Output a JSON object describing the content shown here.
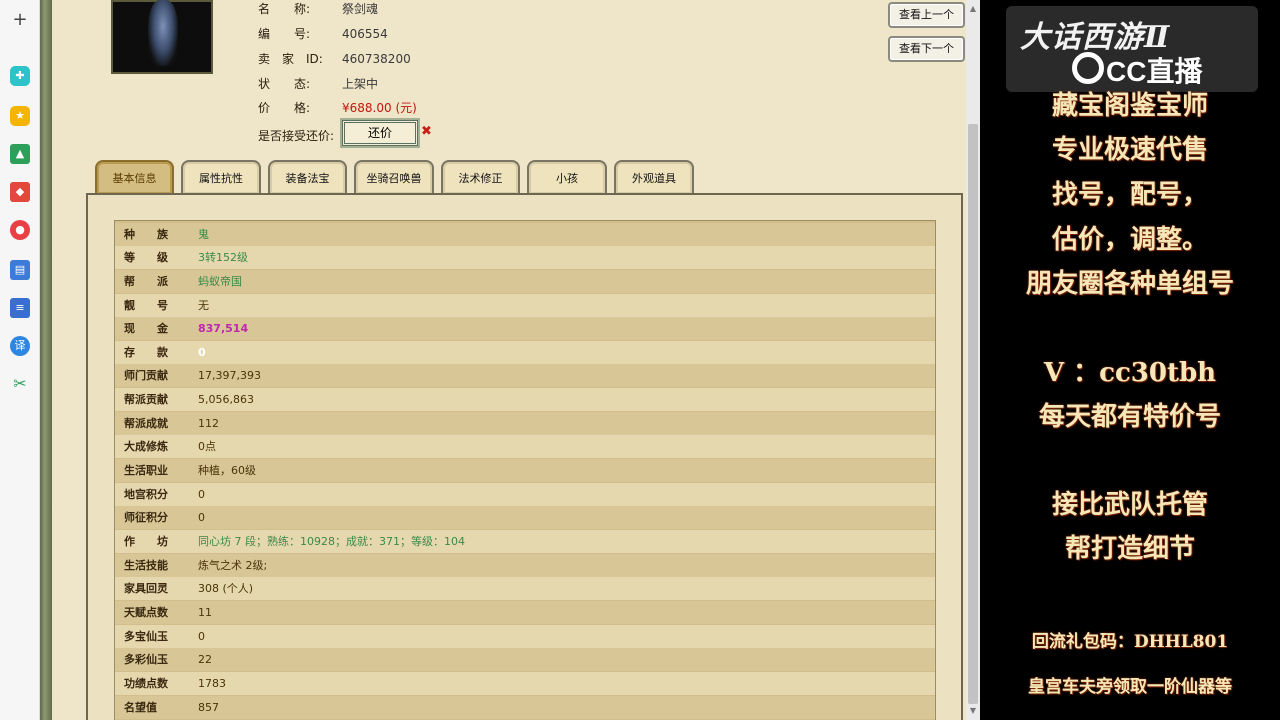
{
  "strip": {
    "plus": "+",
    "icons": [
      "app-icon-1",
      "star-icon",
      "image-ai-icon",
      "pdf-ai-icon",
      "record-ai-icon",
      "chart-ai-icon",
      "doc-ai-icon",
      "translate-icon",
      "scissors-icon"
    ],
    "translate_label": "译"
  },
  "item": {
    "name_label": "名　　称:",
    "name": "祭剑魂",
    "serial_label": "编　　号:",
    "serial": "406554",
    "seller_label": "卖　家　ID:",
    "seller_id": "460738200",
    "status_label": "状　　态:",
    "status": "上架中",
    "price_label": "价　　格:",
    "price": "¥688.00 (元)",
    "counter_label": "是否接受还价:",
    "counter_button": "还价",
    "counter_x": "✖"
  },
  "nav": {
    "prev": "查看上一个",
    "next": "查看下一个"
  },
  "tabs": [
    {
      "label": "基本信息",
      "active": true
    },
    {
      "label": "属性抗性",
      "active": false
    },
    {
      "label": "装备法宝",
      "active": false
    },
    {
      "label": "坐骑召唤兽",
      "active": false
    },
    {
      "label": "法术修正",
      "active": false
    },
    {
      "label": "小孩",
      "active": false
    },
    {
      "label": "外观道具",
      "active": false
    }
  ],
  "rows": [
    {
      "label": "种　　族",
      "value": "鬼",
      "style": "green"
    },
    {
      "label": "等　　级",
      "value": "3转152级",
      "style": "green"
    },
    {
      "label": "帮　　派",
      "value": "蚂蚁帝国",
      "style": "green"
    },
    {
      "label": "靓　　号",
      "value": "无",
      "style": "brown"
    },
    {
      "label": "现　　金",
      "value": "837,514",
      "style": "pink"
    },
    {
      "label": "存　　款",
      "value": "0",
      "style": "white"
    },
    {
      "label": "师门贡献",
      "value": "17,397,393",
      "style": "brown"
    },
    {
      "label": "帮派贡献",
      "value": "5,056,863",
      "style": "brown"
    },
    {
      "label": "帮派成就",
      "value": "112",
      "style": "brown"
    },
    {
      "label": "大成修炼",
      "value": "0点",
      "style": "brown"
    },
    {
      "label": "生活职业",
      "value": "种植，60级",
      "style": "brown"
    },
    {
      "label": "地宫积分",
      "value": "0",
      "style": "brown"
    },
    {
      "label": "师征积分",
      "value": "0",
      "style": "brown"
    },
    {
      "label": "作　　坊",
      "value": "同心坊 7 段；熟练：10928；成就：371；等级：104",
      "style": "green"
    },
    {
      "label": "生活技能",
      "value": "炼气之术 2级;",
      "style": "brown"
    },
    {
      "label": "家具回灵",
      "value": "308 (个人)",
      "style": "brown"
    },
    {
      "label": "天赋点数",
      "value": "11",
      "style": "brown"
    },
    {
      "label": "多宝仙玉",
      "value": "0",
      "style": "brown"
    },
    {
      "label": "多彩仙玉",
      "value": "22",
      "style": "brown"
    },
    {
      "label": "功绩点数",
      "value": "1783",
      "style": "brown"
    },
    {
      "label": "名望值",
      "value": "857",
      "style": "brown"
    }
  ],
  "promo": {
    "logo_title": "大话西游Ⅱ",
    "logo_cc": "CC直播",
    "lines": [
      "藏宝阁鉴宝师",
      "专业极速代售",
      "找号，配号，",
      "估价，调整。",
      "朋友圈各种单组号",
      "V ：cc30tbh",
      "每天都有特价号",
      "接比武队托管",
      "帮打造细节",
      "回流礼包码：DHHL801",
      "皇宫车夫旁领取一阶仙器等"
    ]
  },
  "colors": {
    "accent_green": "#3a8a4a",
    "price_red": "#c0180c",
    "cash_pink": "#c027b0",
    "promo_text": "#f5e7b8"
  }
}
